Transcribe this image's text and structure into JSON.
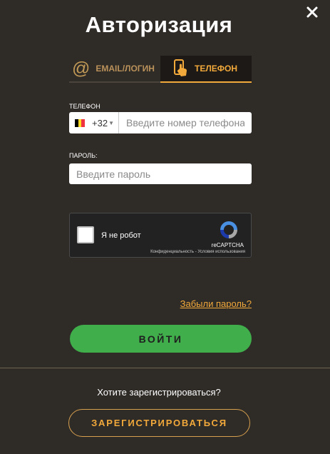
{
  "modal": {
    "title": "Авторизация",
    "close_icon": "close-icon"
  },
  "tabs": [
    {
      "label": "EMAIL/ЛОГИН",
      "icon": "at-sign-icon",
      "active": false
    },
    {
      "label": "ТЕЛЕФОН",
      "icon": "phone-tap-icon",
      "active": true
    }
  ],
  "phone": {
    "label": "ТЕЛЕФОН",
    "country_flag": "belgium-flag-icon",
    "flag_colors": [
      "#000000",
      "#fdda24",
      "#ef3340"
    ],
    "country_code": "+32",
    "placeholder": "Введите номер телефона"
  },
  "password": {
    "label": "ПАРОЛЬ:",
    "placeholder": "Введите пароль"
  },
  "captcha": {
    "label": "Я не робот",
    "brand": "reCAPTCHA",
    "privacy": "Конфиденциальность",
    "separator": " - ",
    "terms": "Условия использования"
  },
  "forgot_password": "Забыли пароль?",
  "login_button": "ВОЙТИ",
  "register": {
    "question": "Хотите зарегистрироваться?",
    "button": "ЗАРЕГИСТРИРОВАТЬСЯ"
  },
  "colors": {
    "background": "#2f2b27",
    "accent": "#f2a93b",
    "login_green": "#3fae4b"
  }
}
